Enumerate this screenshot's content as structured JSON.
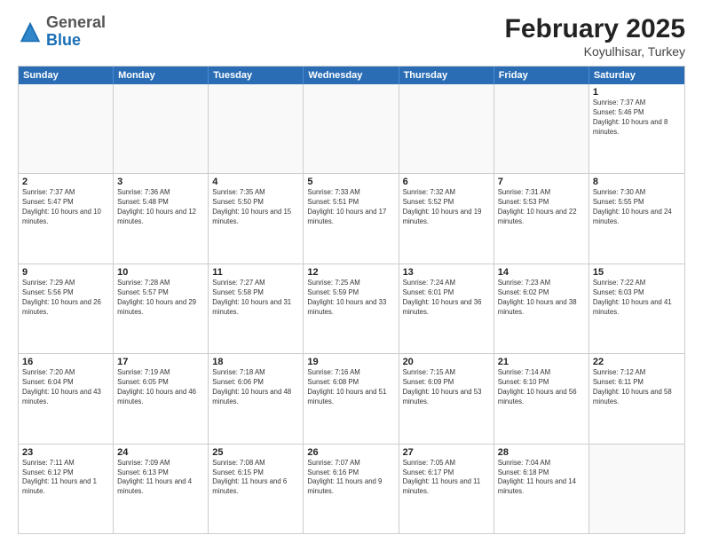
{
  "header": {
    "logo": {
      "general": "General",
      "blue": "Blue"
    },
    "title": "February 2025",
    "subtitle": "Koyulhisar, Turkey"
  },
  "weekdays": [
    "Sunday",
    "Monday",
    "Tuesday",
    "Wednesday",
    "Thursday",
    "Friday",
    "Saturday"
  ],
  "weeks": [
    [
      {
        "day": "",
        "info": ""
      },
      {
        "day": "",
        "info": ""
      },
      {
        "day": "",
        "info": ""
      },
      {
        "day": "",
        "info": ""
      },
      {
        "day": "",
        "info": ""
      },
      {
        "day": "",
        "info": ""
      },
      {
        "day": "1",
        "info": "Sunrise: 7:37 AM\nSunset: 5:46 PM\nDaylight: 10 hours and 8 minutes."
      }
    ],
    [
      {
        "day": "2",
        "info": "Sunrise: 7:37 AM\nSunset: 5:47 PM\nDaylight: 10 hours and 10 minutes."
      },
      {
        "day": "3",
        "info": "Sunrise: 7:36 AM\nSunset: 5:48 PM\nDaylight: 10 hours and 12 minutes."
      },
      {
        "day": "4",
        "info": "Sunrise: 7:35 AM\nSunset: 5:50 PM\nDaylight: 10 hours and 15 minutes."
      },
      {
        "day": "5",
        "info": "Sunrise: 7:33 AM\nSunset: 5:51 PM\nDaylight: 10 hours and 17 minutes."
      },
      {
        "day": "6",
        "info": "Sunrise: 7:32 AM\nSunset: 5:52 PM\nDaylight: 10 hours and 19 minutes."
      },
      {
        "day": "7",
        "info": "Sunrise: 7:31 AM\nSunset: 5:53 PM\nDaylight: 10 hours and 22 minutes."
      },
      {
        "day": "8",
        "info": "Sunrise: 7:30 AM\nSunset: 5:55 PM\nDaylight: 10 hours and 24 minutes."
      }
    ],
    [
      {
        "day": "9",
        "info": "Sunrise: 7:29 AM\nSunset: 5:56 PM\nDaylight: 10 hours and 26 minutes."
      },
      {
        "day": "10",
        "info": "Sunrise: 7:28 AM\nSunset: 5:57 PM\nDaylight: 10 hours and 29 minutes."
      },
      {
        "day": "11",
        "info": "Sunrise: 7:27 AM\nSunset: 5:58 PM\nDaylight: 10 hours and 31 minutes."
      },
      {
        "day": "12",
        "info": "Sunrise: 7:25 AM\nSunset: 5:59 PM\nDaylight: 10 hours and 33 minutes."
      },
      {
        "day": "13",
        "info": "Sunrise: 7:24 AM\nSunset: 6:01 PM\nDaylight: 10 hours and 36 minutes."
      },
      {
        "day": "14",
        "info": "Sunrise: 7:23 AM\nSunset: 6:02 PM\nDaylight: 10 hours and 38 minutes."
      },
      {
        "day": "15",
        "info": "Sunrise: 7:22 AM\nSunset: 6:03 PM\nDaylight: 10 hours and 41 minutes."
      }
    ],
    [
      {
        "day": "16",
        "info": "Sunrise: 7:20 AM\nSunset: 6:04 PM\nDaylight: 10 hours and 43 minutes."
      },
      {
        "day": "17",
        "info": "Sunrise: 7:19 AM\nSunset: 6:05 PM\nDaylight: 10 hours and 46 minutes."
      },
      {
        "day": "18",
        "info": "Sunrise: 7:18 AM\nSunset: 6:06 PM\nDaylight: 10 hours and 48 minutes."
      },
      {
        "day": "19",
        "info": "Sunrise: 7:16 AM\nSunset: 6:08 PM\nDaylight: 10 hours and 51 minutes."
      },
      {
        "day": "20",
        "info": "Sunrise: 7:15 AM\nSunset: 6:09 PM\nDaylight: 10 hours and 53 minutes."
      },
      {
        "day": "21",
        "info": "Sunrise: 7:14 AM\nSunset: 6:10 PM\nDaylight: 10 hours and 56 minutes."
      },
      {
        "day": "22",
        "info": "Sunrise: 7:12 AM\nSunset: 6:11 PM\nDaylight: 10 hours and 58 minutes."
      }
    ],
    [
      {
        "day": "23",
        "info": "Sunrise: 7:11 AM\nSunset: 6:12 PM\nDaylight: 11 hours and 1 minute."
      },
      {
        "day": "24",
        "info": "Sunrise: 7:09 AM\nSunset: 6:13 PM\nDaylight: 11 hours and 4 minutes."
      },
      {
        "day": "25",
        "info": "Sunrise: 7:08 AM\nSunset: 6:15 PM\nDaylight: 11 hours and 6 minutes."
      },
      {
        "day": "26",
        "info": "Sunrise: 7:07 AM\nSunset: 6:16 PM\nDaylight: 11 hours and 9 minutes."
      },
      {
        "day": "27",
        "info": "Sunrise: 7:05 AM\nSunset: 6:17 PM\nDaylight: 11 hours and 11 minutes."
      },
      {
        "day": "28",
        "info": "Sunrise: 7:04 AM\nSunset: 6:18 PM\nDaylight: 11 hours and 14 minutes."
      },
      {
        "day": "",
        "info": ""
      }
    ]
  ]
}
